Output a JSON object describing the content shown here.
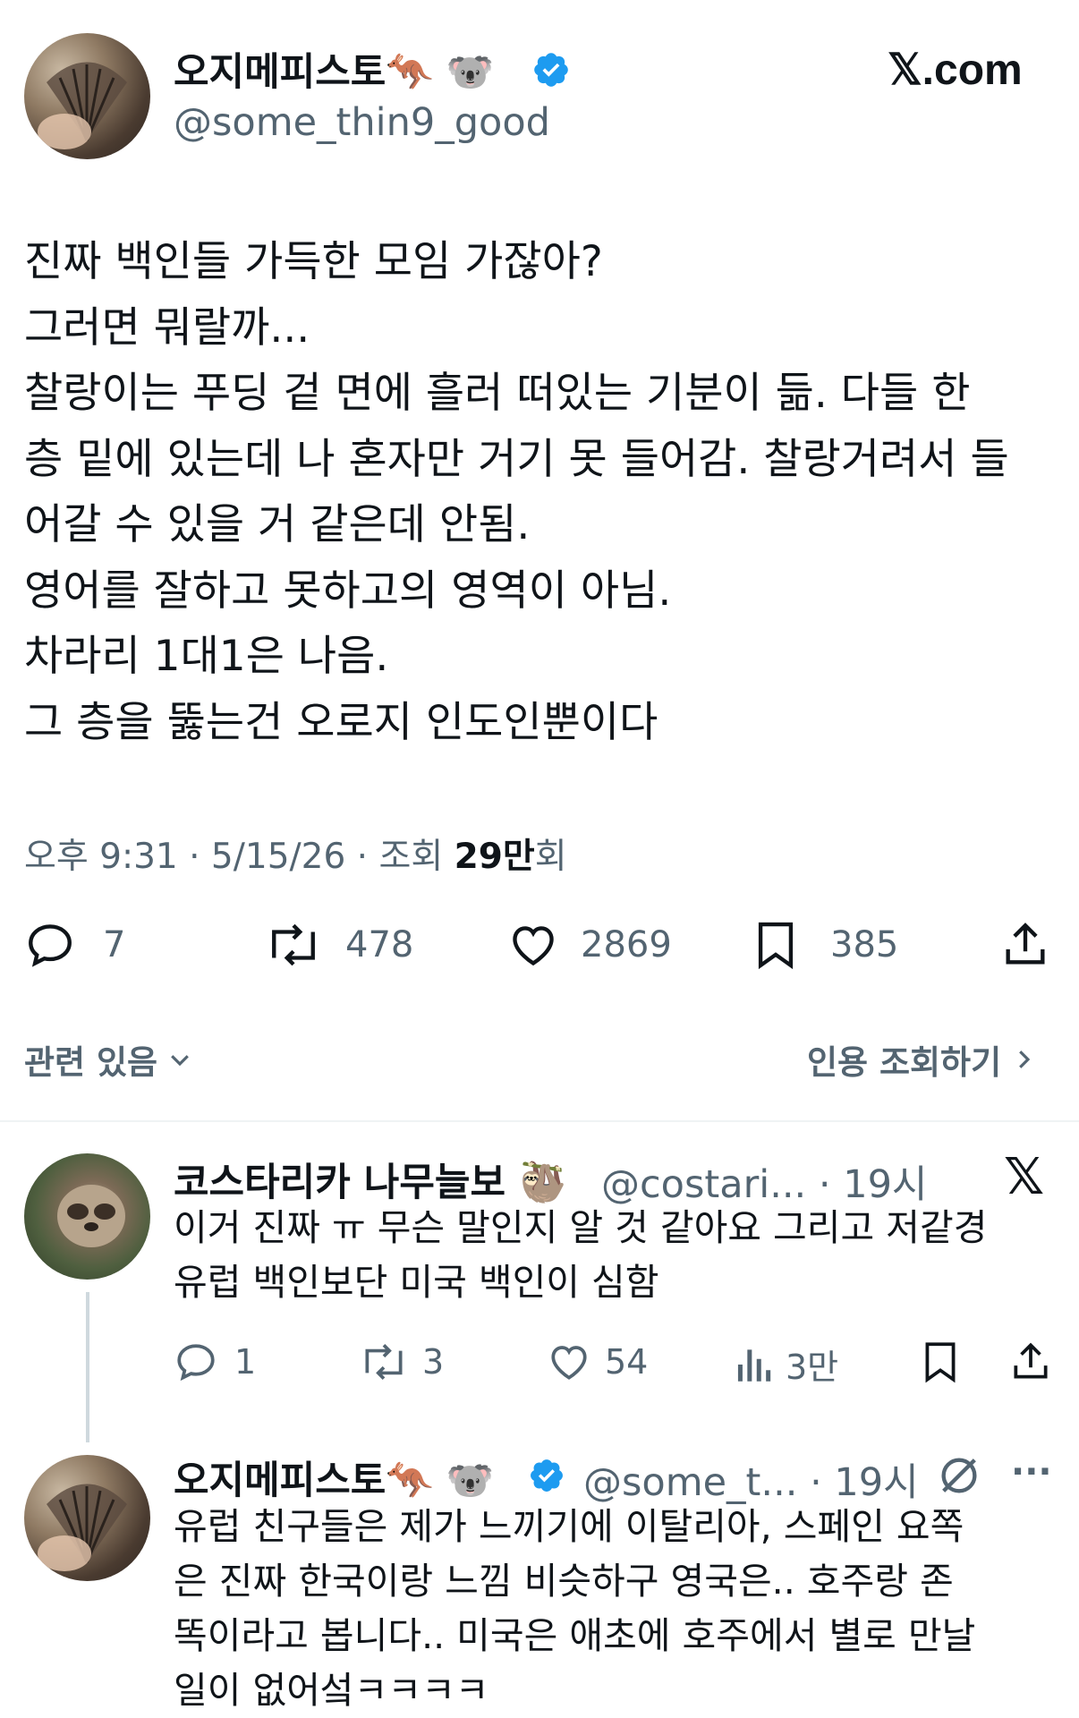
{
  "header": {
    "author_name": "오지메피스토",
    "author_emoji": "🦘 🐨",
    "author_handle": "@some_thin9_good",
    "site_logo": "𝕏.com"
  },
  "tweet": {
    "text": "진짜 백인들 가득한 모임 가잖아?\n그러면 뭐랄까...\n찰랑이는 푸딩 겉 면에 흘러 떠있는 기분이 듦. 다들 한\n층 밑에 있는데 나 혼자만 거기 못 들어감. 찰랑거려서 들\n어갈 수 있을 거 같은데 안됨.\n영어를 잘하고 못하고의 영역이 아님.\n차라리 1대1은 나음.\n그 층을 뚫는건 오로지 인도인뿐이다",
    "time_meta": "오후 9:31 · 5/15/26 · 조회",
    "views_value": "29만",
    "views_suffix": "회",
    "actions": {
      "replies": "7",
      "retweets": "478",
      "likes": "2869",
      "bookmarks": "385"
    },
    "related_label": "관련 있음",
    "quote_label": "인용 조회하기"
  },
  "replies": [
    {
      "author_name": "코스타리카 나무늘보",
      "author_emoji": "🦥",
      "author_handle": "@costari...",
      "time": "· 19시",
      "text": "이거 진짜 ㅠ 무슨 말인지 알 것 같아요 그리고 저같경\n유럽 백인보단 미국 백인이 심함",
      "actions": {
        "replies": "1",
        "retweets": "3",
        "likes": "54",
        "views": "3만"
      }
    },
    {
      "author_name": "오지메피스토",
      "author_emoji": "🦘 🐨",
      "author_handle": "@some_t...",
      "time": "· 19시",
      "text": "유럽 친구들은 제가 느끼기에 이탈리아, 스페인 요쪽\n은 진짜 한국이랑 느낌 비슷하구 영국은.. 호주랑 존\n똑이라고 봅니다.. 미국은 애초에 호주에서 별로 만날\n일이 없어섴ㅋㅋㅋㅋ"
    }
  ],
  "colors": {
    "text": "#0f1419",
    "secondary": "#536471",
    "verified": "#1d9bf0",
    "divider": "#eff3f4"
  },
  "icons": [
    "verified-badge-icon",
    "x-logo-icon",
    "reply-icon",
    "retweet-icon",
    "like-icon",
    "bookmark-icon",
    "share-icon",
    "chevron-down-icon",
    "chevron-right-icon",
    "views-icon",
    "grok-icon",
    "more-icon"
  ]
}
